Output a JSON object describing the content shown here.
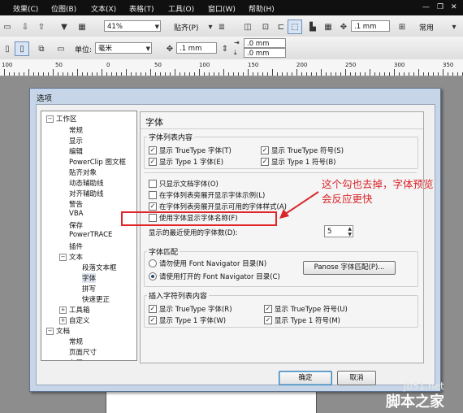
{
  "menu": {
    "items": [
      "效果(C)",
      "位图(B)",
      "文本(X)",
      "表格(T)",
      "工具(O)",
      "窗口(W)",
      "帮助(H)"
    ],
    "minimize": "—",
    "restore": "❐",
    "close": "✕"
  },
  "toolbar1": {
    "zoom": "41%",
    "snap_label": "贴齐(P)",
    "nudge": ".1 mm",
    "common_label": "常用"
  },
  "toolbar2": {
    "unit_label": "单位:",
    "unit_value": "毫米",
    "nudge": ".1 mm",
    "dup_x": ".0 mm",
    "dup_y": ".0 mm"
  },
  "ruler": {
    "labels": [
      "100",
      "50",
      "0",
      "50",
      "100",
      "150",
      "200",
      "250",
      "300",
      "350"
    ]
  },
  "dialog": {
    "title": "选项",
    "tree": {
      "workspace": "工作区",
      "normal": "常规",
      "display": "显示",
      "edit": "编辑",
      "powerclip": "PowerClip 图文框",
      "snap": "贴齐对象",
      "dynamic": "动态辅助线",
      "align": "对齐辅助线",
      "warn": "警告",
      "vba": "VBA",
      "save": "保存",
      "powertrace": "PowerTRACE",
      "plugin": "插件",
      "text": "文本",
      "para": "段落文本框",
      "font": "字体",
      "spell": "拼写",
      "quick": "快速更正",
      "toolbox": "工具箱",
      "custom": "自定义",
      "doc": "文档",
      "doc_normal": "常规",
      "pagesize": "页面尺寸",
      "layout": "布局"
    },
    "panel_title": "字体",
    "list_group": {
      "label": "字体列表内容",
      "tt_font": "显示 TrueType 字体(T)",
      "tt_symbol": "显示 TrueType 符号(S)",
      "t1_font": "显示 Type 1 字体(E)",
      "t1_symbol": "显示 Type 1 符号(B)"
    },
    "only_doc_fonts": "只显示文档字体(O)",
    "show_sample": "在字体列表旁展开显示字体示例(L)",
    "show_styles": "在字体列表旁展开显示可用的字体样式(A)",
    "use_font_name": "使用字体显示字体名称(F)",
    "recent_label": "显示的最近使用的字体数(D):",
    "recent_value": "5",
    "match_group": {
      "label": "字体匹配",
      "opt1": "请勿使用 Font Navigator 目录(N)",
      "opt2": "请使用打开的 Font Navigator 目录(C)",
      "panose": "Panose 字体匹配(P)..."
    },
    "insert_group": {
      "label": "插入字符列表内容",
      "tt_font": "显示 TrueType 字体(R)",
      "tt_symbol": "显示 TrueType 符号(U)",
      "t1_font": "显示 Type 1 字体(W)",
      "t1_symbol": "显示 Type 1 符号(M)"
    },
    "ok": "确定",
    "cancel": "取消"
  },
  "annotation": {
    "line1": "这个勾也去掉，字体预览",
    "line2": "会反应更快"
  },
  "watermark": {
    "site": "jb51.net",
    "name": "脚本之家"
  },
  "colors": {
    "annotation": "#d9262b",
    "dialog_frame": "#c6d5e7"
  }
}
